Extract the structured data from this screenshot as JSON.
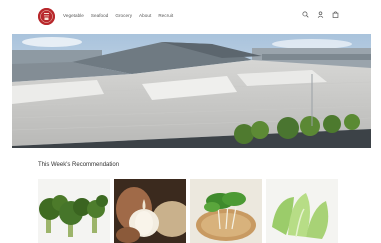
{
  "nav": {
    "items": [
      "Vegetable",
      "Seafood",
      "Grocery",
      "About",
      "Recruit"
    ]
  },
  "header_icons": [
    "search-icon",
    "account-icon",
    "cart-icon"
  ],
  "logo": {
    "accent": "#b8282c"
  },
  "hero": {
    "image": "market-building-rooftop"
  },
  "recommendation": {
    "title": "This Week's Recommendation",
    "products": [
      {
        "image": "broccoli"
      },
      {
        "image": "garlic"
      },
      {
        "image": "pea-sprouts"
      },
      {
        "image": "cabbage"
      }
    ]
  }
}
